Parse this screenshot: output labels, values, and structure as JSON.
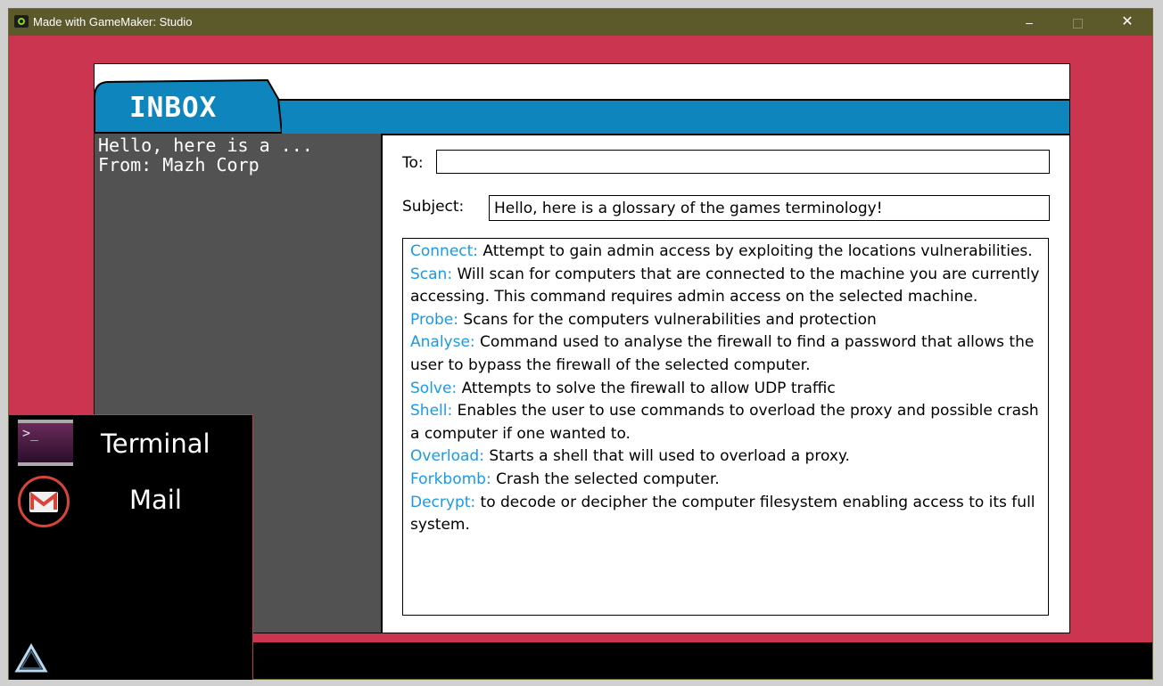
{
  "window": {
    "title": "Made with GameMaker: Studio",
    "minimize": "–",
    "close": "✕"
  },
  "mail": {
    "tab_title": "INBOX",
    "list": [
      {
        "preview": "Hello, here is a ...",
        "from": "From: Mazh Corp"
      }
    ],
    "to_label": "To:",
    "to_value": "",
    "subject_label": "Subject:",
    "subject_value": "Hello, here is a glossary of the games terminology!",
    "body": [
      {
        "term": "Connect:",
        "text": " Attempt to gain admin access by exploiting the locations vulnerabilities."
      },
      {
        "term": "Scan:",
        "text": "  Will scan for computers that are connected to the machine you are currently accessing. This command requires admin access on the selected machine."
      },
      {
        "term": "Probe:",
        "text": " Scans for the computers vulnerabilities and protection"
      },
      {
        "term": "Analyse:",
        "text": "  Command used to analyse the firewall to find  a password that allows the user to bypass the firewall of the selected computer."
      },
      {
        "term": "Solve:",
        "text": " Attempts to solve the firewall to allow UDP traffic"
      },
      {
        "term": "Shell:",
        "text": " Enables the user to use commands to overload the proxy and possible crash a computer if one wanted to."
      },
      {
        "term": "Overload:",
        "text": " Starts a shell that will used to overload a proxy."
      },
      {
        "term": "Forkbomb:",
        "text": " Crash the selected computer."
      },
      {
        "term": "Decrypt:",
        "text": "  to decode or decipher the computer filesystem enabling access to its full system."
      }
    ]
  },
  "launcher": {
    "items": [
      {
        "label": "Terminal",
        "icon": "terminal-icon"
      },
      {
        "label": "Mail",
        "icon": "gmail-icon"
      }
    ]
  },
  "colors": {
    "background": "#cc3550",
    "header_blue": "#0e86bd",
    "term_blue": "#1a9ae6",
    "list_gray": "#525252",
    "titlebar": "#5c5a2a"
  }
}
